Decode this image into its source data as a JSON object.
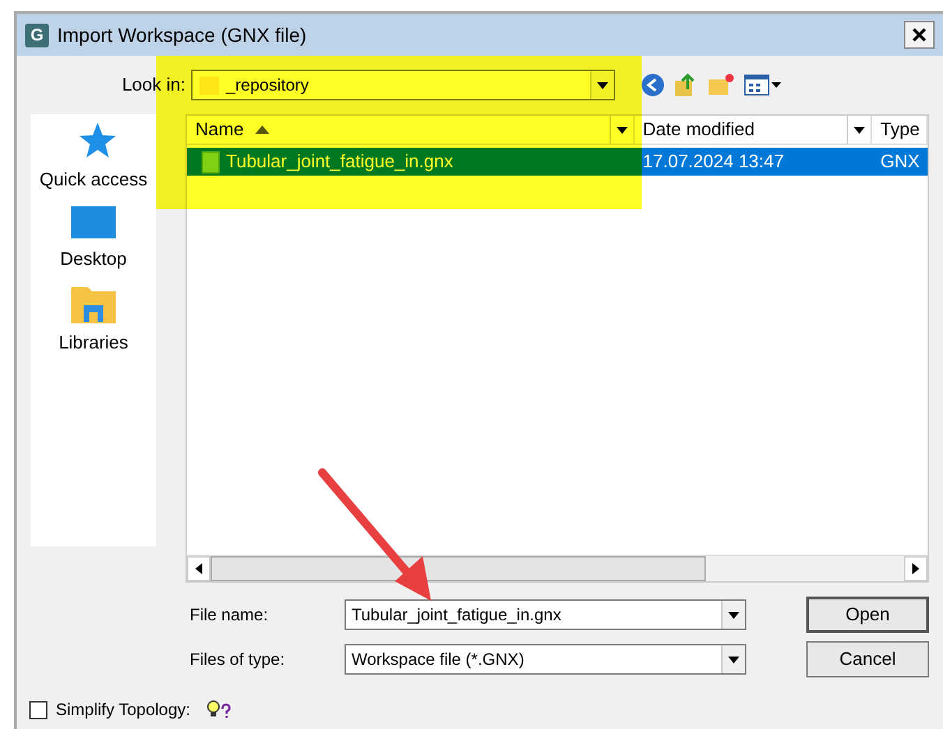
{
  "window": {
    "title": "Import Workspace (GNX file)",
    "icon_letter": "G"
  },
  "look_in": {
    "label": "Look in:",
    "value": "_repository"
  },
  "places": [
    {
      "label": "Quick access",
      "kind": "star"
    },
    {
      "label": "Desktop",
      "kind": "desktop"
    },
    {
      "label": "Libraries",
      "kind": "libraries"
    }
  ],
  "file_list": {
    "columns": [
      "Name",
      "Date modified",
      "Type"
    ],
    "rows": [
      {
        "name": "Tubular_joint_fatigue_in.gnx",
        "date_modified": "17.07.2024 13:47",
        "type": "GNX",
        "selected": true
      }
    ]
  },
  "file_name": {
    "label": "File name:",
    "value": "Tubular_joint_fatigue_in.gnx"
  },
  "files_of_type": {
    "label": "Files of type:",
    "value": "Workspace file (*.GNX)"
  },
  "buttons": [
    "Open",
    "Cancel"
  ],
  "simplify_topology": {
    "label": "Simplify Topology:",
    "checked": false
  }
}
